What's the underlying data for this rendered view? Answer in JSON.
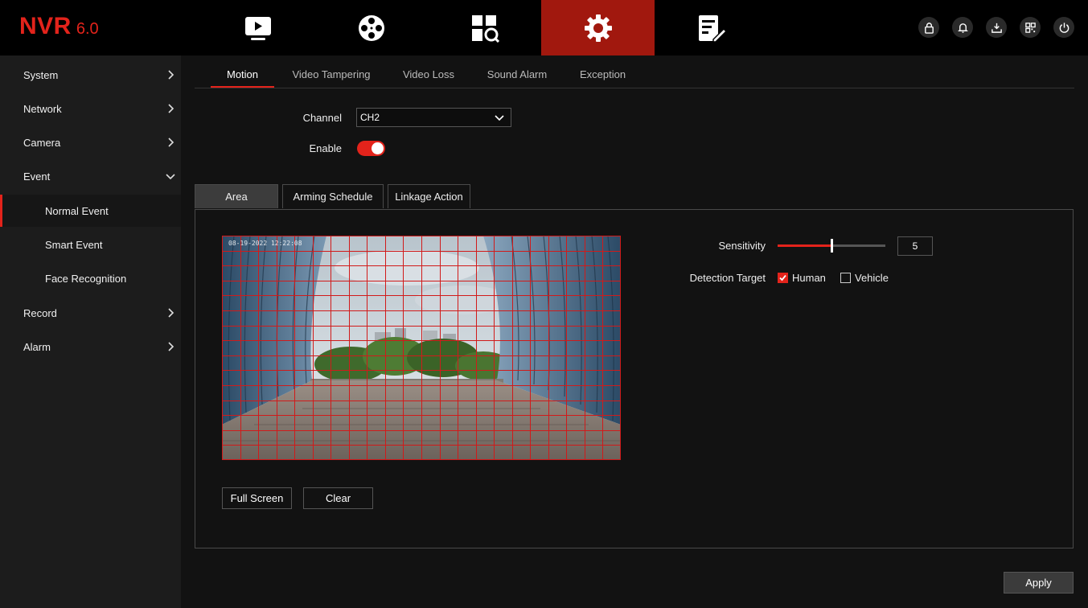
{
  "app": {
    "brand": "NVR",
    "version": "6.0",
    "accent_color": "#e3231b"
  },
  "top_nav": [
    {
      "icon": "playback-icon"
    },
    {
      "icon": "film-reel-icon"
    },
    {
      "icon": "search-grid-icon"
    },
    {
      "icon": "gear-icon",
      "active": true
    },
    {
      "icon": "notes-tool-icon"
    }
  ],
  "header_icons": [
    "lock-icon",
    "bell-icon",
    "download-icon",
    "qr-code-icon",
    "power-icon"
  ],
  "sidebar": {
    "items": [
      {
        "label": "System",
        "chevron": "right"
      },
      {
        "label": "Network",
        "chevron": "right"
      },
      {
        "label": "Camera",
        "chevron": "right"
      },
      {
        "label": "Event",
        "chevron": "down"
      },
      {
        "label": "Normal Event",
        "sub": true,
        "active": true
      },
      {
        "label": "Smart Event",
        "sub": true
      },
      {
        "label": "Face Recognition",
        "sub": true
      },
      {
        "label": "Record",
        "chevron": "right"
      },
      {
        "label": "Alarm",
        "chevron": "right"
      }
    ]
  },
  "tabs": [
    {
      "label": "Motion",
      "active": true
    },
    {
      "label": "Video Tampering"
    },
    {
      "label": "Video Loss"
    },
    {
      "label": "Sound Alarm"
    },
    {
      "label": "Exception"
    }
  ],
  "form": {
    "channel_label": "Channel",
    "channel_value": "CH2",
    "enable_label": "Enable",
    "enabled": true
  },
  "subtabs": [
    {
      "label": "Area",
      "active": true
    },
    {
      "label": "Arming Schedule"
    },
    {
      "label": "Linkage Action"
    }
  ],
  "area": {
    "grid_color": "#d11a1a",
    "osd_text": "08-19-2022 12:22:08",
    "full_screen_label": "Full Screen",
    "clear_label": "Clear"
  },
  "settings": {
    "sensitivity_label": "Sensitivity",
    "sensitivity_value": "5",
    "sensitivity_fraction": 0.5,
    "detection_target_label": "Detection Target",
    "human_label": "Human",
    "human_checked": true,
    "vehicle_label": "Vehicle",
    "vehicle_checked": false
  },
  "apply_label": "Apply"
}
